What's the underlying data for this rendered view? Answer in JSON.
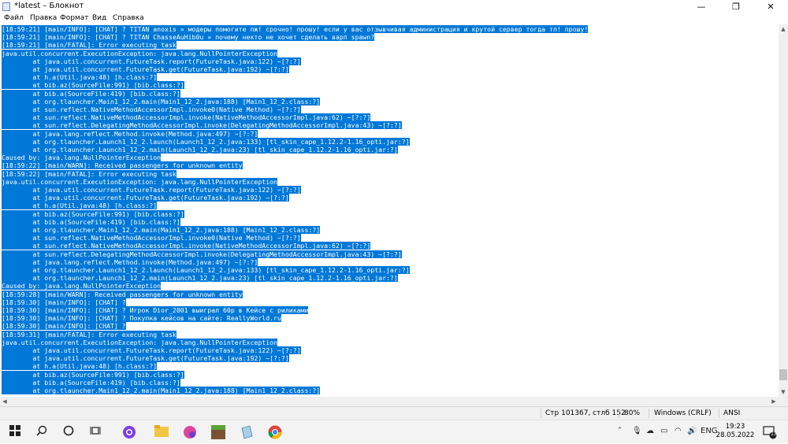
{
  "window": {
    "title": "*latest – Блокнот",
    "minimize_glyph": "—",
    "maximize_glyph": "❐",
    "close_glyph": "✕"
  },
  "menu": [
    "Файл",
    "Правка",
    "Формат",
    "Вид",
    "Справка"
  ],
  "lines": [
    "[18:59:21] [main/INFO]: [CHAT] ? TITAN anoxis » модеры помогите пж! срочно! прошу! если у вас отзывчивая администрация и крутой сервер тогда тп! прошу!",
    "[18:59:21] [main/INFO]: [CHAT] ? TITAN ChasseAuHib0u » почему некто не хочет сделать варп spawn?",
    "[18:59:21] [main/FATAL]: Error executing task",
    "java.util.concurrent.ExecutionException: java.lang.NullPointerException",
    "\tat java.util.concurrent.FutureTask.report(FutureTask.java:122) ~[?:?]",
    "\tat java.util.concurrent.FutureTask.get(FutureTask.java:192) ~[?:?]",
    "\tat h.a(Util.java:48) [h.class:?]",
    "\tat bib.az(SourceFile:991) [bib.class:?]",
    "\tat bib.a(SourceFile:419) [bib.class:?]",
    "\tat org.tlauncher.Main1_12_2.main(Main1_12_2.java:188) [Main1_12_2.class:?]",
    "\tat sun.reflect.NativeMethodAccessorImpl.invoke0(Native Method) ~[?:?]",
    "\tat sun.reflect.NativeMethodAccessorImpl.invoke(NativeMethodAccessorImpl.java:62) ~[?:?]",
    "\tat sun.reflect.DelegatingMethodAccessorImpl.invoke(DelegatingMethodAccessorImpl.java:43) ~[?:?]",
    "\tat java.lang.reflect.Method.invoke(Method.java:497) ~[?:?]",
    "\tat org.tlauncher.Launch1_12_2.launch(Launch1_12_2.java:133) [tl_skin_cape_1.12.2-1.16_opti.jar:?]",
    "\tat org.tlauncher.Launch1_12_2.main(Launch1_12_2.java:23) [tl_skin_cape_1.12.2-1.16_opti.jar:?]",
    "Caused by: java.lang.NullPointerException",
    "[18:59:22] [main/WARN]: Received passengers for unknown entity",
    "[18:59:22] [main/FATAL]: Error executing task",
    "java.util.concurrent.ExecutionException: java.lang.NullPointerException",
    "\tat java.util.concurrent.FutureTask.report(FutureTask.java:122) ~[?:?]",
    "\tat java.util.concurrent.FutureTask.get(FutureTask.java:192) ~[?:?]",
    "\tat h.a(Util.java:48) [h.class:?]",
    "\tat bib.az(SourceFile:991) [bib.class:?]",
    "\tat bib.a(SourceFile:419) [bib.class:?]",
    "\tat org.tlauncher.Main1_12_2.main(Main1_12_2.java:188) [Main1_12_2.class:?]",
    "\tat sun.reflect.NativeMethodAccessorImpl.invoke0(Native Method) ~[?:?]",
    "\tat sun.reflect.NativeMethodAccessorImpl.invoke(NativeMethodAccessorImpl.java:62) ~[?:?]",
    "\tat sun.reflect.DelegatingMethodAccessorImpl.invoke(DelegatingMethodAccessorImpl.java:43) ~[?:?]",
    "\tat java.lang.reflect.Method.invoke(Method.java:497) ~[?:?]",
    "\tat org.tlauncher.Launch1_12_2.launch(Launch1_12_2.java:133) [tl_skin_cape_1.12.2-1.16_opti.jar:?]",
    "\tat org.tlauncher.Launch1_12_2.main(Launch1_12_2.java:23) [tl_skin_cape_1.12.2-1.16_opti.jar:?]",
    "Caused by: java.lang.NullPointerException",
    "[18:59:28] [main/WARN]: Received passengers for unknown entity",
    "[18:59:30] [main/INFO]: [CHAT] ?",
    "[18:59:30] [main/INFO]: [CHAT] ? Игрок Dior_2001 выиграл 60р в Кейсе с риликами",
    "[18:59:30] [main/INFO]: [CHAT] ? Покупка кейсов на сайте: ReallyWorld.ru",
    "[18:59:30] [main/INFO]: [CHAT] ?",
    "[18:59:31] [main/FATAL]: Error executing task",
    "java.util.concurrent.ExecutionException: java.lang.NullPointerException",
    "\tat java.util.concurrent.FutureTask.report(FutureTask.java:122) ~[?:?]",
    "\tat java.util.concurrent.FutureTask.get(FutureTask.java:192) ~[?:?]",
    "\tat h.a(Util.java:48) [h.class:?]",
    "\tat bib.az(SourceFile:991) [bib.class:?]",
    "\tat bib.a(SourceFile:419) [bib.class:?]",
    "\tat org.tlauncher.Main1_12_2.main(Main1_12_2.java:188) [Main1_12_2.class:?]"
  ],
  "status": {
    "position": "Стр 101367, стлб 152",
    "zoom": "80%",
    "line_ending": "Windows (CRLF)",
    "encoding": "ANSI"
  },
  "taskbar": {
    "language": "ENG",
    "time": "19:23",
    "date": "28.05.2022",
    "notification_count": "13"
  },
  "colors": {
    "selection": "#0078d7"
  }
}
